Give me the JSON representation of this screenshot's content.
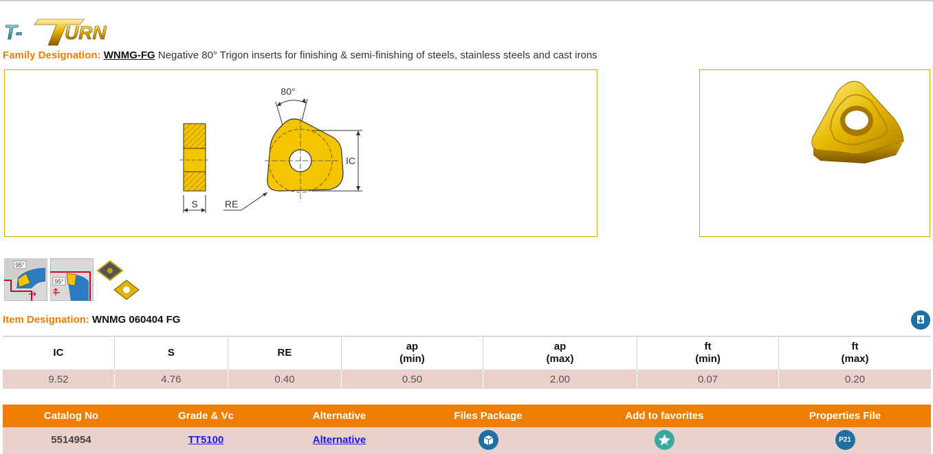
{
  "brand": {
    "logo_text": "T-TURN"
  },
  "family": {
    "label": "Family Designation:",
    "code": "WNMG-FG",
    "description": "Negative 80° Trigon inserts for finishing & semi-finishing of steels, stainless steels and cast irons"
  },
  "drawing": {
    "angle_label": "80°",
    "ic_label": "IC",
    "s_label": "S",
    "re_label": "RE"
  },
  "thumbnails": {
    "holder1_angle": "95°",
    "holder2_angle": "95°"
  },
  "item": {
    "label": "Item Designation:",
    "value": "WNMG 060404 FG"
  },
  "params": {
    "headers": [
      {
        "line1": "IC",
        "line2": ""
      },
      {
        "line1": "S",
        "line2": ""
      },
      {
        "line1": "RE",
        "line2": ""
      },
      {
        "line1": "ap",
        "line2": "(min)"
      },
      {
        "line1": "ap",
        "line2": "(max)"
      },
      {
        "line1": "ft",
        "line2": "(min)"
      },
      {
        "line1": "ft",
        "line2": "(max)"
      }
    ],
    "values": [
      "9.52",
      "4.76",
      "0.40",
      "0.50",
      "2.00",
      "0.07",
      "0.20"
    ]
  },
  "catalog": {
    "headers": [
      "Catalog No",
      "Grade & Vc",
      "Alternative",
      "Files Package",
      "Add to favorites",
      "Properties File"
    ],
    "row": {
      "catalog_no": "5514954",
      "grade": "TT5100",
      "alternative": "Alternative",
      "properties_badge": "P21"
    }
  },
  "colors": {
    "accent_orange": "#ee7d00",
    "row_pink": "#ead1cc",
    "insert_yellow": "#f5c400",
    "icon_blue": "#1f6fa3"
  }
}
